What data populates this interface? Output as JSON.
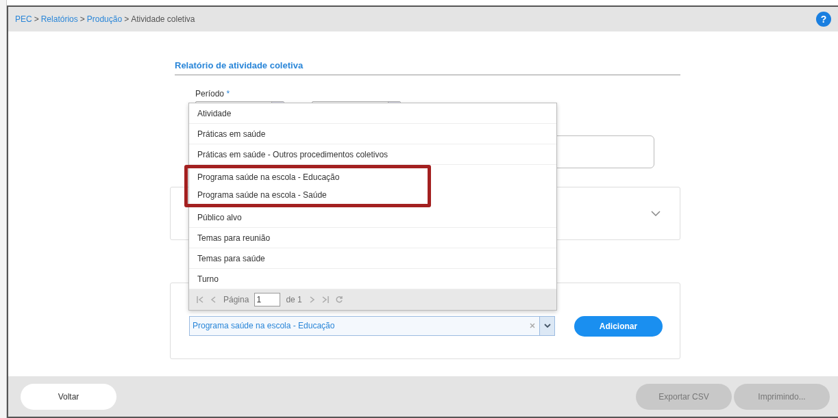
{
  "breadcrumb": {
    "separator": ">",
    "items": [
      {
        "label": "PEC",
        "link": true
      },
      {
        "label": "Relatórios",
        "link": true
      },
      {
        "label": "Produção",
        "link": true
      },
      {
        "label": "Atividade coletiva",
        "link": false
      }
    ]
  },
  "help": "?",
  "section_title": "Relatório de atividade coletiva",
  "period": {
    "label": "Período",
    "required_mark": "*"
  },
  "dropdown": {
    "items": [
      {
        "label": "Atividade",
        "highlighted": false
      },
      {
        "label": "Práticas em saúde",
        "highlighted": false
      },
      {
        "label": "Práticas em saúde - Outros procedimentos coletivos",
        "highlighted": false
      },
      {
        "label": "Programa saúde na escola - Educação",
        "highlighted": true
      },
      {
        "label": "Programa saúde na escola - Saúde",
        "highlighted": true
      },
      {
        "label": "Público alvo",
        "highlighted": false
      },
      {
        "label": "Temas para reunião",
        "highlighted": false
      },
      {
        "label": "Temas para saúde",
        "highlighted": false
      },
      {
        "label": "Turno",
        "highlighted": false
      }
    ],
    "pager": {
      "page_label": "Página",
      "page_value": "1",
      "of_label": "de 1"
    }
  },
  "combobox": {
    "value": "Programa saúde na escola - Educação"
  },
  "add_button": "Adicionar",
  "footer": {
    "back": "Voltar",
    "buttons": [
      {
        "label": "Exportar CSV",
        "disabled": true
      },
      {
        "label": "Imprimindo...",
        "disabled": true
      }
    ]
  }
}
